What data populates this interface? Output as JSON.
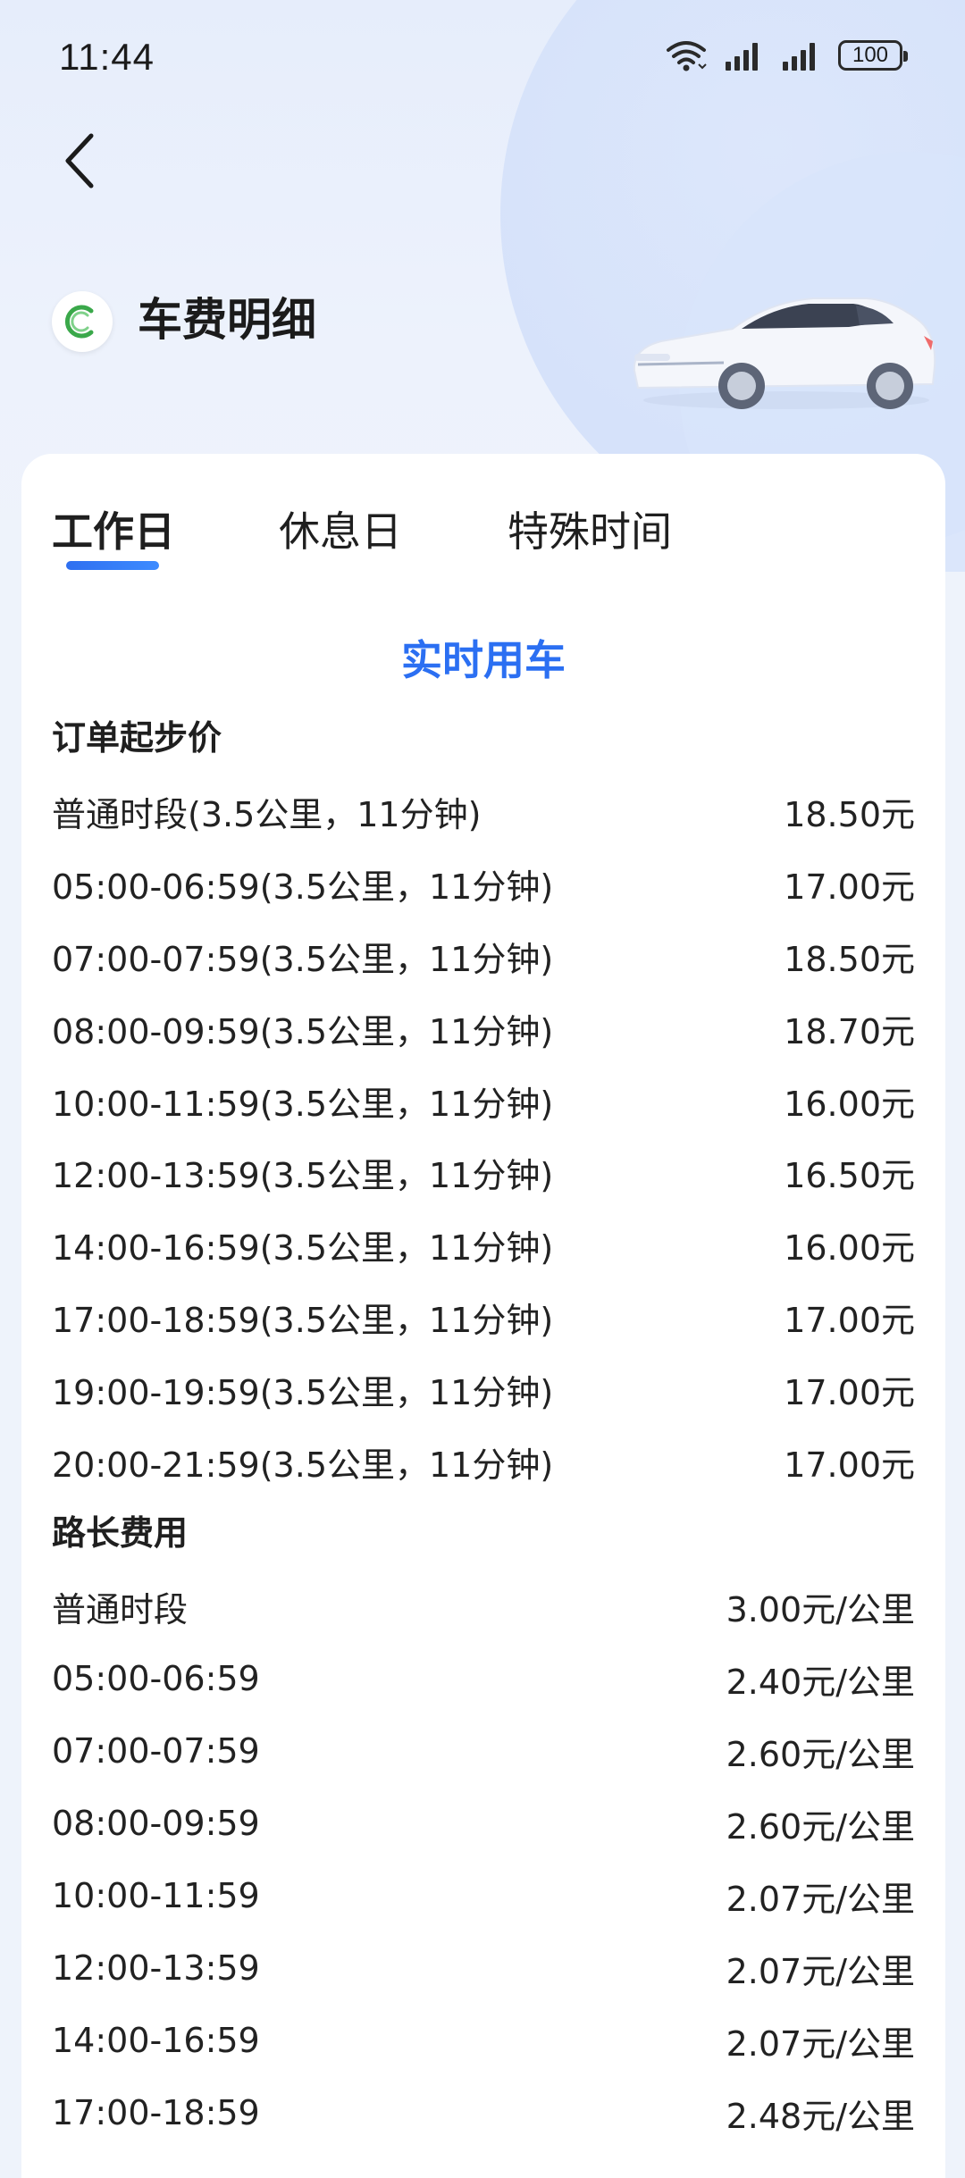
{
  "status_bar": {
    "time": "11:44",
    "battery": "100"
  },
  "header": {
    "title": "车费明细"
  },
  "tabs": [
    {
      "label": "工作日",
      "active": true
    },
    {
      "label": "休息日",
      "active": false
    },
    {
      "label": "特殊时间",
      "active": false
    }
  ],
  "section_heading": "实时用车",
  "groups": {
    "start_price": {
      "title": "订单起步价",
      "rows": [
        {
          "label": "普通时段(3.5公里，11分钟)",
          "value": "18.50元"
        },
        {
          "label": "05:00-06:59(3.5公里，11分钟)",
          "value": "17.00元"
        },
        {
          "label": "07:00-07:59(3.5公里，11分钟)",
          "value": "18.50元"
        },
        {
          "label": "08:00-09:59(3.5公里，11分钟)",
          "value": "18.70元"
        },
        {
          "label": "10:00-11:59(3.5公里，11分钟)",
          "value": "16.00元"
        },
        {
          "label": "12:00-13:59(3.5公里，11分钟)",
          "value": "16.50元"
        },
        {
          "label": "14:00-16:59(3.5公里，11分钟)",
          "value": "16.00元"
        },
        {
          "label": "17:00-18:59(3.5公里，11分钟)",
          "value": "17.00元"
        },
        {
          "label": "19:00-19:59(3.5公里，11分钟)",
          "value": "17.00元"
        },
        {
          "label": "20:00-21:59(3.5公里，11分钟)",
          "value": "17.00元"
        }
      ]
    },
    "distance_fee": {
      "title": "路长费用",
      "rows": [
        {
          "label": "普通时段",
          "value": "3.00元/公里"
        },
        {
          "label": "05:00-06:59",
          "value": "2.40元/公里"
        },
        {
          "label": "07:00-07:59",
          "value": "2.60元/公里"
        },
        {
          "label": "08:00-09:59",
          "value": "2.60元/公里"
        },
        {
          "label": "10:00-11:59",
          "value": "2.07元/公里"
        },
        {
          "label": "12:00-13:59",
          "value": "2.07元/公里"
        },
        {
          "label": "14:00-16:59",
          "value": "2.07元/公里"
        },
        {
          "label": "17:00-18:59",
          "value": "2.48元/公里"
        }
      ]
    }
  },
  "colors": {
    "accent": "#2b6ff2",
    "brand_green": "#3aa84a"
  }
}
